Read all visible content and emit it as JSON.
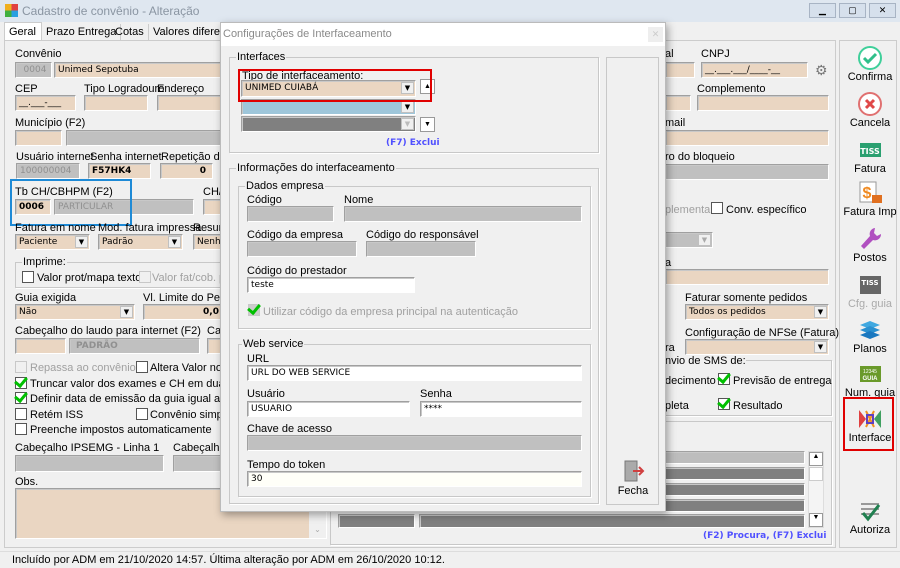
{
  "window": {
    "title": "Cadastro de convênio - Alteração",
    "minimize": "▁",
    "maximize": "▢",
    "close": "✕"
  },
  "tabs": [
    "Geral",
    "Prazo Entrega",
    "Cotas",
    "Valores diferenc"
  ],
  "form": {
    "convenio_label": "Convênio",
    "convenio_code": "0004",
    "convenio_name": "Unimed Sepotuba",
    "cep_label": "CEP",
    "cep_value": "__.___-___",
    "tipo_logradouro_label": "Tipo Logradouro",
    "endereco_label": "Endereço",
    "municipio_label": "Município (F2)",
    "usuario_internet_label": "Usuário internet",
    "usuario_internet": "100000004",
    "senha_internet_label": "Senha internet",
    "senha_internet": "F57HK4",
    "repeticao_label": "Repetição de",
    "repeticao": "0",
    "tb_ch_label": "Tb CH/CBHPM (F2)",
    "tb_ch_code": "0006",
    "tb_ch_name": "PARTICULAR",
    "ch_label": "CH/",
    "fatura_nome_label": "Fatura em nome",
    "fatura_nome": "Paciente",
    "mod_fatura_label": "Mod. fatura impressa",
    "mod_fatura": "Padrão",
    "resum_label": "Resum",
    "resum": "Nenh",
    "imprime_label": "Imprime:",
    "valor_prot": "Valor prot/mapa texto",
    "valor_fat": "Valor fat/cob. pr",
    "guia_exigida_label": "Guia exigida",
    "guia_exigida": "Não",
    "vl_limite_label": "Vl. Limite do Pedic",
    "vl_limite": "0,0",
    "cabecalho_laudo_label": "Cabeçalho do laudo para internet (F2)",
    "cabecalho_laudo": "PADRÃO",
    "cal_label": "Cal",
    "repassa": "Repassa ao convênio",
    "altera_valor": "Altera Valor no p",
    "truncar": "Truncar valor dos exames e CH em duas dec",
    "definir_data": "Definir data de emissão da guia igual a data c",
    "retem_iss": "Retém ISS",
    "convenio_simples": "Convênio simple",
    "preenche_impostos": "Preenche impostos automaticamente",
    "ipsemg_label": "Cabeçalho IPSEMG - Linha 1",
    "cabecalho2_label": "Cabeçalho",
    "obs_label": "Obs.",
    "al_label": "al",
    "cnpj_label": "CNPJ",
    "cnpj_value": "__.___.___/____-__",
    "complemento_label": "Complemento",
    "email_label": "mail",
    "bloqueio_label": "ro do bloqueio",
    "complementar": "plementar",
    "conv_especifico": "Conv. específico",
    "a_label": "a",
    "faturar_pedidos_label": "Faturar somente pedidos",
    "faturar_pedidos": "Todos os pedidos",
    "nfse_label": "Configuração de NFSe (Fatura)",
    "ra_label": "ra",
    "sms_label": "nvio de SMS de:",
    "vencimento": "decimento",
    "previsao": "Previsão de entrega",
    "completa": "pleta",
    "resultado": "Resultado",
    "procura_exclui": "(F2) Procura, (F7) Exclui"
  },
  "toolbar": [
    {
      "label": "Confirma",
      "icon": "check-circle-icon"
    },
    {
      "label": "Cancela",
      "icon": "x-circle-icon"
    },
    {
      "label": "Fatura",
      "icon": "tiss-icon"
    },
    {
      "label": "Fatura Imp",
      "icon": "invoice-print-icon"
    },
    {
      "label": "Postos",
      "icon": "wrench-icon"
    },
    {
      "label": "Cfg. guia",
      "icon": "tiss-config-icon",
      "disabled": true
    },
    {
      "label": "Planos",
      "icon": "layers-icon"
    },
    {
      "label": "Num. guia",
      "icon": "guia-number-icon"
    },
    {
      "label": "Interface",
      "icon": "interface-icon",
      "highlighted": true
    },
    {
      "label": "Autoriza",
      "icon": "authorize-icon"
    }
  ],
  "dialog": {
    "title": "Configurações de Interfaceamento",
    "close": "✕",
    "interfaces_label": "Interfaces",
    "tipo_label": "Tipo de interfaceamento:",
    "tipo_value": "UNIMED CUIABÁ",
    "exclui": "(F7) Exclui",
    "info_label": "Informações do interfaceamento",
    "dados_label": "Dados empresa",
    "codigo_label": "Código",
    "nome_label": "Nome",
    "codigo_empresa_label": "Código da empresa",
    "codigo_responsavel_label": "Código do responsável",
    "codigo_prestador_label": "Código do prestador",
    "codigo_prestador": "teste",
    "utilizar_codigo": "Utilizar código da empresa principal na autenticação",
    "web_label": "Web service",
    "url_label": "URL",
    "url": "URL DO WEB SERVICE",
    "usuario_label": "Usuário",
    "usuario": "USUARIO",
    "senha_label": "Senha",
    "senha": "****",
    "chave_label": "Chave de acesso",
    "tempo_label": "Tempo do token",
    "tempo": "30",
    "fecha": "Fecha"
  },
  "status": "Incluído por ADM em 21/10/2020 14:57. Última alteração por ADM em 26/10/2020 10:12.",
  "colors": {
    "field": "#ead6c2",
    "disabled": "#c0c0c0",
    "highlight_red": "#e00000",
    "highlight_blue": "#1e8ad6",
    "link": "#5050ff"
  }
}
